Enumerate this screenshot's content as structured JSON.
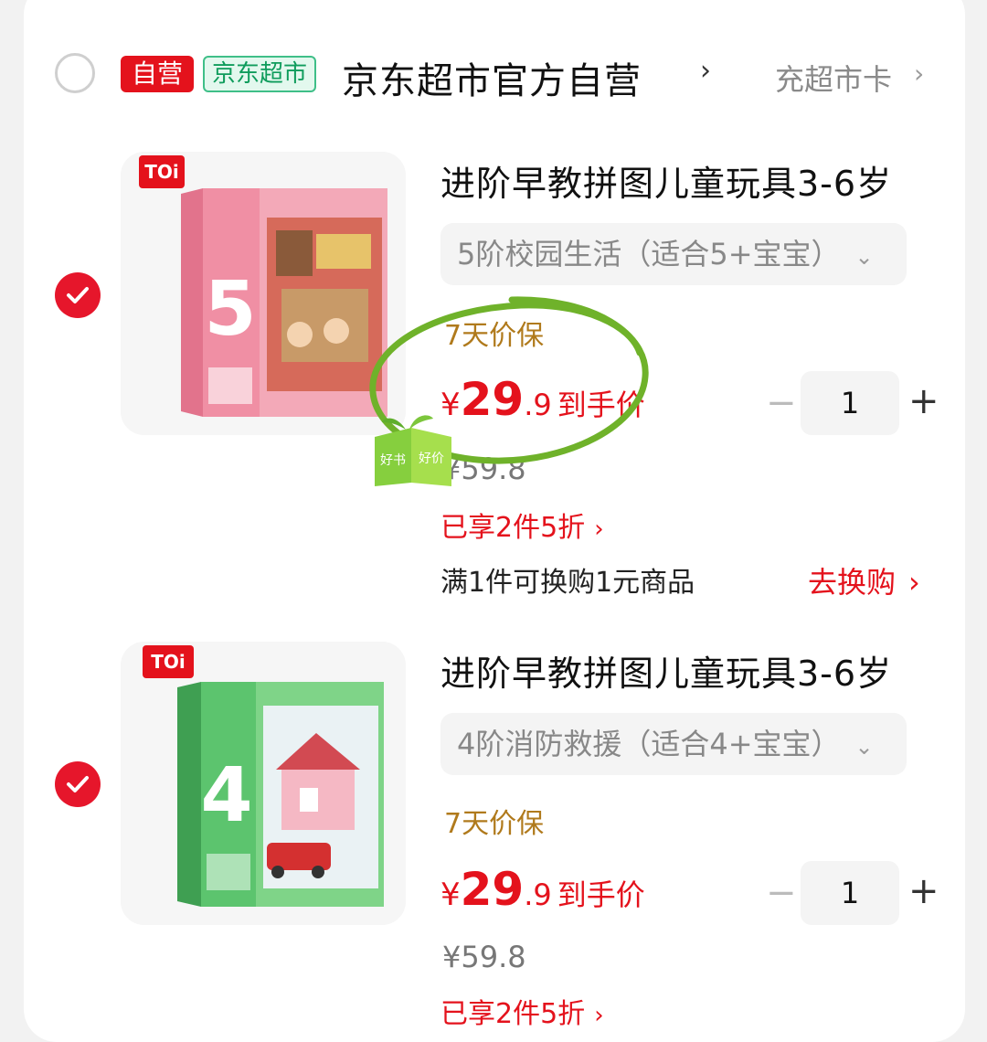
{
  "shop": {
    "self_tag": "自营",
    "market_tag": "京东超市",
    "name": "京东超市官方自营",
    "name_chevron": "›",
    "recharge_label": "充超市卡",
    "recharge_chevron": "›"
  },
  "items": [
    {
      "selected": true,
      "brand": "TOi",
      "title": "进阶早教拼图儿童玩具3-6岁",
      "variant": "5阶校园生活（适合5+宝宝）",
      "variant_chevron": "⌄",
      "guarantee": "7天价保",
      "price_symbol": "¥",
      "price_int": "29",
      "price_dec": ".9",
      "price_suffix": "到手价",
      "original_price": "¥59.8",
      "discount": "已享2件5折",
      "discount_chevron": "›",
      "exchange_text": "满1件可换购1元商品",
      "exchange_action": "去换购",
      "exchange_chevron": "›",
      "quantity": "1",
      "box_color": "#f08fa4",
      "box_number": "5"
    },
    {
      "selected": true,
      "brand": "TOi",
      "title": "进阶早教拼图儿童玩具3-6岁",
      "variant": "4阶消防救援（适合4+宝宝）",
      "variant_chevron": "⌄",
      "guarantee": "7天价保",
      "price_symbol": "¥",
      "price_int": "29",
      "price_dec": ".9",
      "price_suffix": "到手价",
      "original_price": "¥59.8",
      "discount": "已享2件5折",
      "discount_chevron": "›",
      "quantity": "1",
      "box_color": "#5cc46e",
      "box_number": "4"
    }
  ],
  "overlay": {
    "sticker_text_left": "好书",
    "sticker_text_right": "好价",
    "circle_color": "#6fb22a"
  },
  "qty_controls": {
    "minus": "−",
    "plus": "+"
  },
  "icons": [
    "radio-empty-icon",
    "check-icon",
    "chevron-right-icon",
    "chevron-down-icon",
    "minus-icon",
    "plus-icon",
    "sticker-icon"
  ]
}
